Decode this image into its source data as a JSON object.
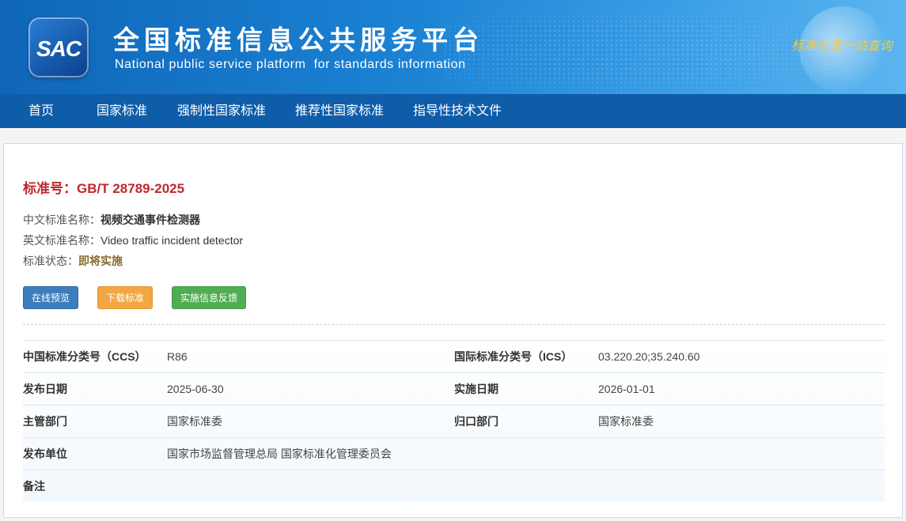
{
  "header": {
    "logo_text": "SAC",
    "title": "全国标准信息公共服务平台",
    "subtitle": "National public service platform  for standards information",
    "slogan": "标准信息一站查询"
  },
  "nav": {
    "items": [
      "首页",
      "国家标准",
      "强制性国家标准",
      "推荐性国家标准",
      "指导性技术文件"
    ]
  },
  "standard": {
    "number_label": "标准号：",
    "number": "GB/T 28789-2025",
    "cn_name_label": "中文标准名称：",
    "cn_name": "视频交通事件检测器",
    "en_name_label": "英文标准名称：",
    "en_name": "Video traffic incident detector",
    "status_label": "标准状态：",
    "status": "即将实施",
    "status_color": "#8a6a2f"
  },
  "buttons": {
    "preview": "在线预览",
    "download": "下载标准",
    "feedback": "实施信息反馈"
  },
  "details": {
    "ccs_label": "中国标准分类号（CCS）",
    "ccs": "R86",
    "ics_label": "国际标准分类号（ICS）",
    "ics": "03.220.20;35.240.60",
    "publish_date_label": "发布日期",
    "publish_date": "2025-06-30",
    "implement_date_label": "实施日期",
    "implement_date": "2026-01-01",
    "competent_dept_label": "主管部门",
    "competent_dept": "国家标准委",
    "responsible_dept_label": "归口部门",
    "responsible_dept": "国家标准委",
    "publisher_label": "发布单位",
    "publisher": "国家市场监督管理总局 国家标准化管理委员会",
    "remarks_label": "备注",
    "remarks": ""
  },
  "colors": {
    "nav_bg": "#0f5da9",
    "standard_no": "#c1272d",
    "btn_preview": "#3c7dbd",
    "btn_download": "#f2a742",
    "btn_feedback": "#51ad52"
  }
}
